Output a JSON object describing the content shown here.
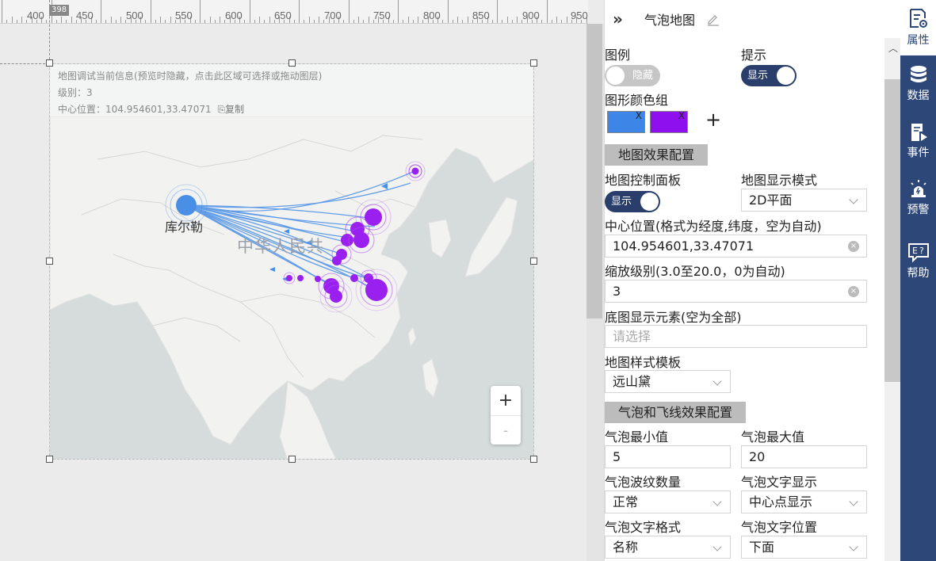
{
  "ruler": {
    "labels": [
      "400",
      "450",
      "500",
      "550",
      "600",
      "650",
      "700",
      "750",
      "800",
      "850",
      "900",
      "950"
    ],
    "badge": "398"
  },
  "map": {
    "info_line1": "地图调试当前信息(预览时隐藏，点击此区域可选择或拖动图层)",
    "info_line2": "级别：3",
    "info_line3_prefix": "中心位置：104.954601,33.47071",
    "copy_label": "复制",
    "city_label": "库尔勒",
    "country_label": "中华人民共",
    "zoom_in": "+",
    "zoom_out": "-"
  },
  "panel": {
    "title": "气泡地图",
    "legend_label": "图例",
    "legend_toggle_text": "隐藏",
    "tooltip_label": "提示",
    "tooltip_toggle_text": "显示",
    "color_group_label": "图形颜色组",
    "color_remove_glyph": "X",
    "add_glyph": "+",
    "colors": [
      "#3d86e8",
      "#8f10ef"
    ],
    "section_map": "地图效果配置",
    "control_panel_label": "地图控制面板",
    "control_panel_toggle_text": "显示",
    "display_mode_label": "地图显示模式",
    "display_mode_value": "2D平面",
    "center_label": "中心位置(格式为经度,纬度，空为自动)",
    "center_value": "104.954601,33.47071",
    "zoom_label": "缩放级别(3.0至20.0，0为自动)",
    "zoom_value": "3",
    "base_elements_label": "底图显示元素(空为全部)",
    "base_elements_placeholder": "请选择",
    "style_template_label": "地图样式模板",
    "style_template_value": "远山黛",
    "section_bubble": "气泡和飞线效果配置",
    "bubble_min_label": "气泡最小值",
    "bubble_min_value": "5",
    "bubble_max_label": "气泡最大值",
    "bubble_max_value": "20",
    "ripple_count_label": "气泡波纹数量",
    "ripple_count_value": "正常",
    "text_display_label": "气泡文字显示",
    "text_display_value": "中心点显示",
    "text_format_label": "气泡文字格式",
    "text_format_value": "名称",
    "text_position_label": "气泡文字位置",
    "text_position_value": "下面"
  },
  "nav": {
    "items": [
      {
        "label": "属性",
        "icon": "properties-icon"
      },
      {
        "label": "数据",
        "icon": "database-icon"
      },
      {
        "label": "事件",
        "icon": "event-icon"
      },
      {
        "label": "预警",
        "icon": "alarm-icon"
      },
      {
        "label": "帮助",
        "icon": "help-icon"
      }
    ]
  }
}
